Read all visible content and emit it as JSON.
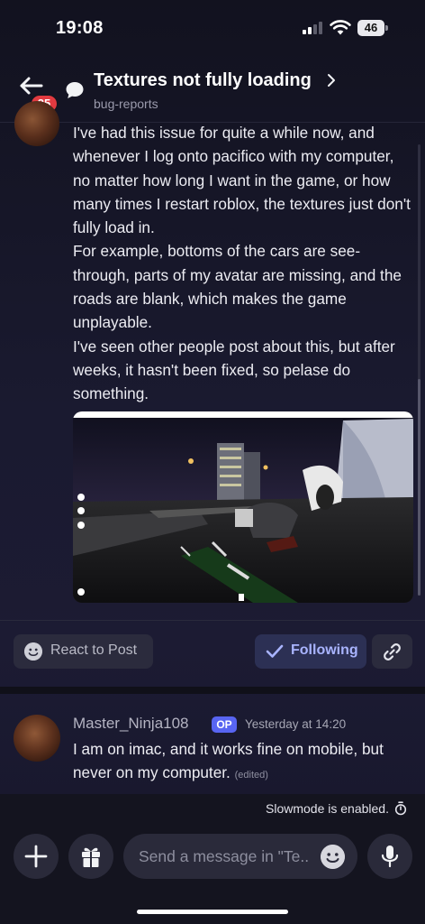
{
  "status_bar": {
    "time": "19:08",
    "battery": "46"
  },
  "header": {
    "unread_badge": "25",
    "title": "Textures not fully loading",
    "channel": "bug-reports"
  },
  "post": {
    "paragraphs": [
      "I've had this issue for quite a while now, and whenever I log onto pacifico with my computer, no matter how long I want in the game, or how many times I restart roblox, the textures just don't fully load in.",
      "For example, bottoms of the cars are see-through, parts of my avatar are missing, and the roads are blank, which makes the game unplayable.",
      "I've seen other people post about this, but after weeks, it hasn't been fixed, so pelase do something."
    ]
  },
  "actions": {
    "react_label": "React to Post",
    "following_label": "Following"
  },
  "reply": {
    "author": "Master_Ninja108",
    "op_badge": "OP",
    "timestamp": "Yesterday at 14:20",
    "text": "I am on imac, and it works fine on mobile, but never on my computer.",
    "edited": "(edited)"
  },
  "slowmode": {
    "text": "Slowmode is enabled."
  },
  "composer": {
    "placeholder": "Send a message in \"Te.."
  },
  "colors": {
    "accent": "#5865f2",
    "following_text": "#a9b4ff",
    "badge_red": "#e23a40",
    "background": "#17172a"
  },
  "icons": [
    "back-arrow-icon",
    "thread-icon",
    "chevron-right-icon",
    "smiley-icon",
    "checkmark-icon",
    "link-icon",
    "stopwatch-icon",
    "plus-icon",
    "gift-icon",
    "emoji-icon",
    "microphone-icon"
  ]
}
